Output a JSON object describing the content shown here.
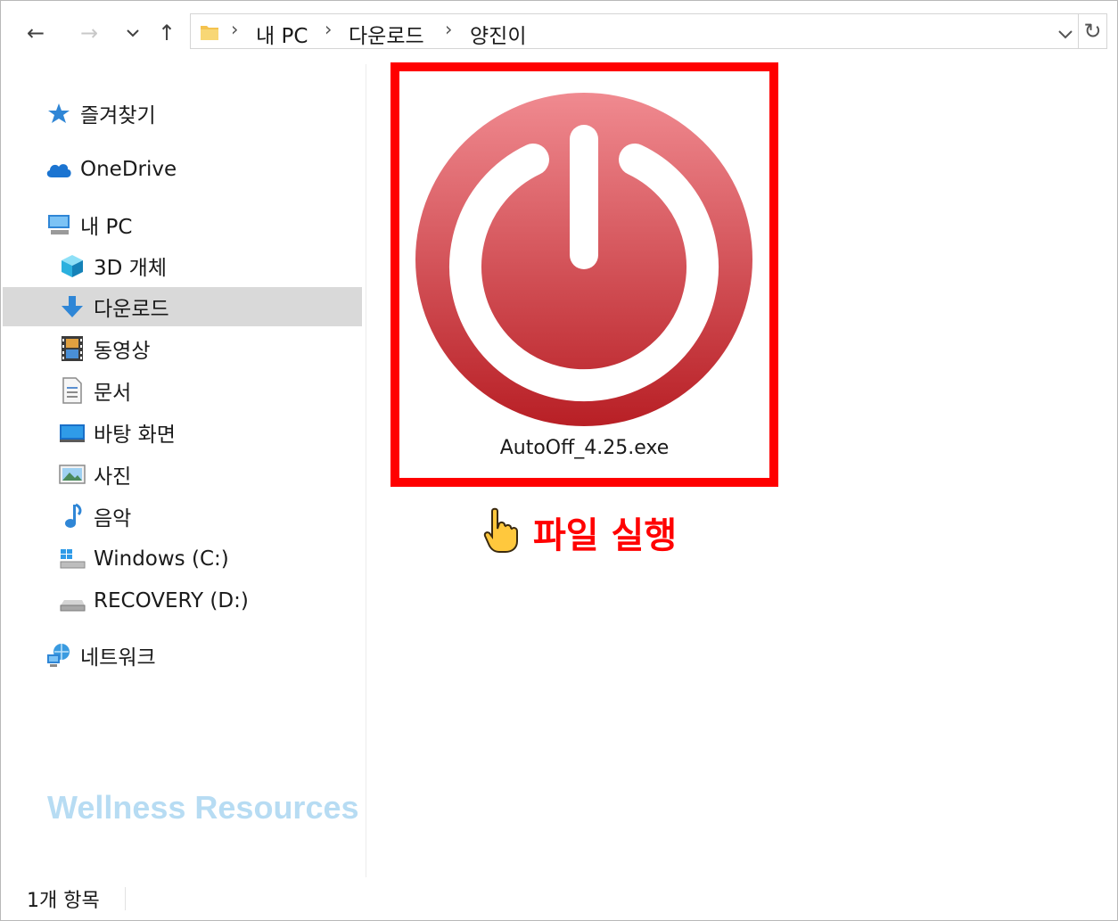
{
  "address_bar": {
    "breadcrumbs": [
      "내 PC",
      "다운로드",
      "양진이"
    ]
  },
  "sidebar": {
    "items": [
      {
        "label": "즐겨찾기",
        "icon": "star-icon"
      },
      {
        "label": "OneDrive",
        "icon": "cloud-icon"
      },
      {
        "label": "내 PC",
        "icon": "computer-icon"
      },
      {
        "label": "3D 개체",
        "icon": "cube-icon"
      },
      {
        "label": "다운로드",
        "icon": "download-arrow-icon",
        "selected": true
      },
      {
        "label": "동영상",
        "icon": "film-icon"
      },
      {
        "label": "문서",
        "icon": "document-icon"
      },
      {
        "label": "바탕 화면",
        "icon": "desktop-icon"
      },
      {
        "label": "사진",
        "icon": "picture-icon"
      },
      {
        "label": "음악",
        "icon": "music-note-icon"
      },
      {
        "label": "Windows (C:)",
        "icon": "windows-drive-icon"
      },
      {
        "label": "RECOVERY (D:)",
        "icon": "drive-icon"
      },
      {
        "label": "네트워크",
        "icon": "network-icon"
      }
    ]
  },
  "content": {
    "file": {
      "name": "AutoOff_4.25.exe",
      "icon": "power-button-icon"
    },
    "callout": "파일 실행"
  },
  "watermark": "Wellness Resources",
  "status": {
    "item_count": "1개 항목"
  },
  "colors": {
    "highlight": "#ff0000",
    "selection": "#d9d9d9",
    "power_top": "#f08a90",
    "power_bottom": "#b81f25"
  }
}
